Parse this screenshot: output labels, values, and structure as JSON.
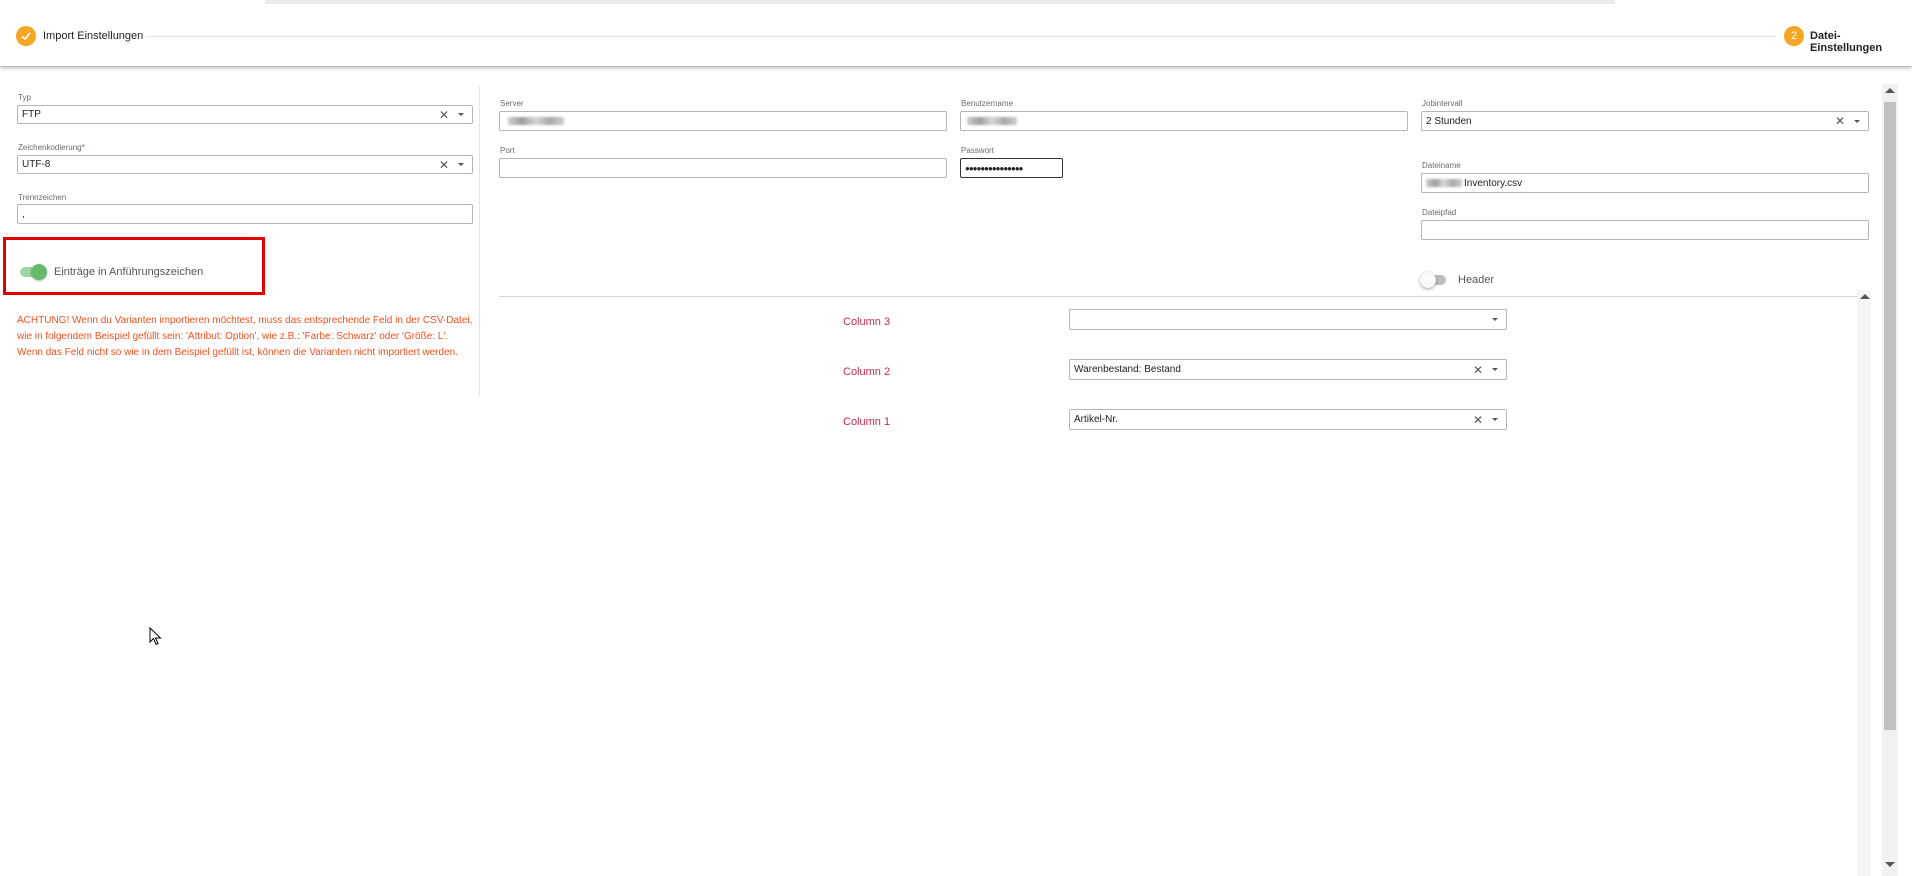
{
  "stepper": {
    "step1": {
      "icon": "check-icon",
      "label": "Import Einstellungen"
    },
    "step2": {
      "number": "2",
      "label": "Datei-Einstellungen"
    }
  },
  "left": {
    "typ": {
      "label": "Typ",
      "value": "FTP"
    },
    "encoding": {
      "label": "Zeichenkodierung",
      "required_mark": "*",
      "value": "UTF-8"
    },
    "separator": {
      "label": "Trennzeichen",
      "value": ","
    },
    "quotes_toggle": {
      "label": "Einträge in Anführungszeichen",
      "on": true
    },
    "warning": "ACHTUNG! Wenn du Varianten importieren möchtest, muss das entsprechende Feld in der CSV-Datei, wie in folgendem Beispiel gefüllt sein: 'Attribut: Option', wie z.B.: 'Farbe: Schwarz' oder 'Größe: L'. Wenn das Feld nicht so wie in dem Beispiel gefüllt ist, können die Varianten nicht importiert werden."
  },
  "right": {
    "server": {
      "label": "Server",
      "value": ""
    },
    "port": {
      "label": "Port",
      "value": ""
    },
    "username": {
      "label": "Benutzername",
      "value": ""
    },
    "password": {
      "label": "Passwort",
      "value": "●●●●●●●●●●●●●●●"
    },
    "jobinterval": {
      "label": "Jobintervall",
      "value": "2 Stunden"
    },
    "filename": {
      "label": "Dateiname",
      "value": "Inventory.csv"
    },
    "filepath": {
      "label": "Dateipfad",
      "value": ""
    },
    "header_toggle": {
      "label": "Header",
      "on": false
    }
  },
  "columns": [
    {
      "label": "Column 3",
      "value": ""
    },
    {
      "label": "Column 2",
      "value": "Warenbestand: Bestand"
    },
    {
      "label": "Column 1",
      "value": "Artikel-Nr."
    }
  ],
  "colors": {
    "accent": "#f5a623",
    "toggle_on": "#66bb6a",
    "warning": "#f4511e",
    "column_label": "#c62850",
    "highlight_box": "#e00000"
  }
}
